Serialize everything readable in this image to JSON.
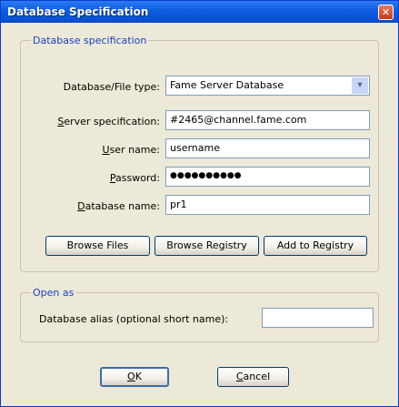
{
  "window": {
    "title": "Database Specification",
    "close_glyph": "✕"
  },
  "group1": {
    "legend": "Database specification",
    "fields": {
      "type": {
        "label_mn": "",
        "label_rest": "Database/File type:",
        "value": "Fame Server Database",
        "arrow": "▾"
      },
      "server": {
        "label_mn": "S",
        "label_rest": "erver specification:",
        "value": "#2465@channel.fame.com"
      },
      "user": {
        "label_mn": "U",
        "label_rest": "ser name:",
        "value": "username"
      },
      "password": {
        "label_mn": "P",
        "label_rest": "assword:",
        "value": "●●●●●●●●●●"
      },
      "dbname": {
        "label_mn": "D",
        "label_rest": "atabase name:",
        "value": "pr1"
      }
    },
    "buttons": {
      "browse_files": "Browse Files",
      "browse_registry": "Browse Registry",
      "add_registry": "Add to Registry"
    }
  },
  "group2": {
    "legend": "Open as",
    "alias_label": "Database alias (optional short name):",
    "alias_value": ""
  },
  "footer": {
    "ok_mn": "O",
    "ok_rest": "K",
    "cancel_mn": "C",
    "cancel_rest": "ancel"
  }
}
